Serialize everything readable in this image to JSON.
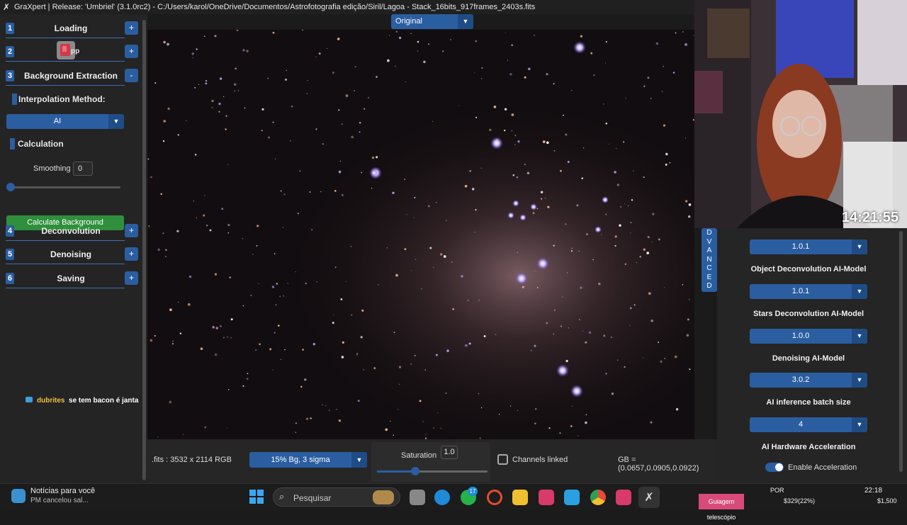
{
  "window": {
    "title": "GraXpert | Release: 'Umbriel' (3.1.0rc2) - C:/Users/karol/OneDrive/Documentos/Astrofotografia edição/Siril/Lagoa - Stack_16bits_917frames_2403s.fits",
    "app_icon": "graxpert-x-icon"
  },
  "sidebar": {
    "steps": [
      {
        "num": "1",
        "label": "Loading",
        "toggle": "+"
      },
      {
        "num": "2",
        "label": "pp",
        "toggle": "+"
      },
      {
        "num": "3",
        "label": "Background Extraction",
        "toggle": "-"
      },
      {
        "num": "4",
        "label": "Deconvolution",
        "toggle": "+"
      },
      {
        "num": "5",
        "label": "Denoising",
        "toggle": "+"
      },
      {
        "num": "6",
        "label": "Saving",
        "toggle": "+"
      }
    ],
    "interpolation_label": "Interpolation Method:",
    "interpolation_value": "AI",
    "calculation_label": "Calculation",
    "smoothing_label": "Smoothing",
    "smoothing_value": "0",
    "smoothing_slider": 0,
    "calculate_button": "Calculate Background"
  },
  "chat": {
    "user": "dubrites",
    "message": "se tem bacon é janta"
  },
  "viewer": {
    "display_mode": "Original"
  },
  "bottom": {
    "image_info": ".fits : 3532 x 2114 RGB",
    "stretch_value": "15% Bg, 3 sigma",
    "saturation_label": "Saturation",
    "saturation_value": "1.0",
    "saturation_slider": 0.35,
    "channels_linked_label": "Channels linked",
    "channels_linked": false,
    "pixel_readout": "GB = (0.0657,0.0905,0.0922)"
  },
  "advanced": {
    "tab_letters": [
      "D",
      "V",
      "A",
      "N",
      "C",
      "E",
      "D"
    ],
    "bge_model_value": "1.0.1",
    "object_deconv_label": "Object Deconvolution AI-Model",
    "object_deconv_value": "1.0.1",
    "stars_deconv_label": "Stars Deconvolution AI-Model",
    "stars_deconv_value": "1.0.0",
    "denoising_label": "Denoising AI-Model",
    "denoising_value": "3.0.2",
    "batch_label": "AI inference batch size",
    "batch_value": "4",
    "hw_label": "AI Hardware Acceleration",
    "hw_toggle_label": "Enable Acceleration",
    "hw_enabled": true
  },
  "webcam": {
    "clock": "14:21:55"
  },
  "taskbar": {
    "news_title": "Notícias para você",
    "news_sub": "PM cancelou sal...",
    "search_placeholder": "Pesquisar",
    "whatsapp_badge": "17",
    "overlay_label": "Guiagem telescópio",
    "lang": "POR",
    "time": "22:18",
    "price1": "$329(22%)",
    "price2": "$1,500"
  },
  "colors": {
    "accent": "#2b5ea0",
    "green": "#2f8f3d",
    "panel": "#242424"
  }
}
